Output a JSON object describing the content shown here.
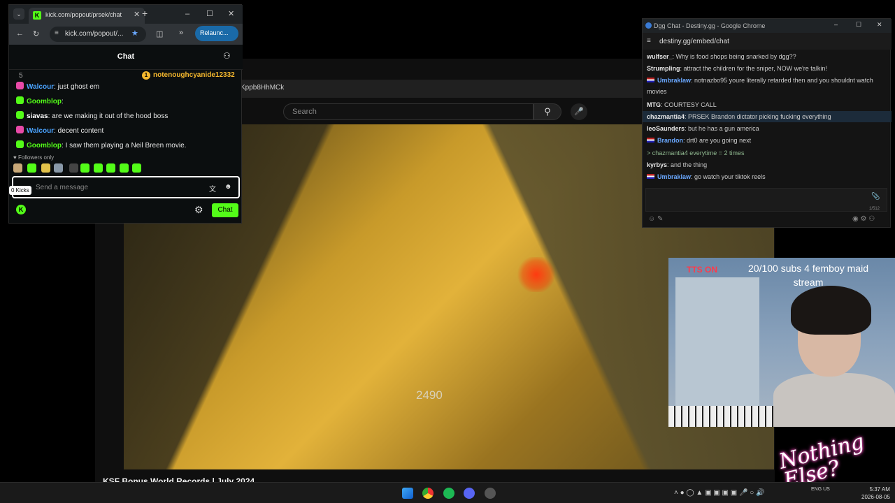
{
  "youtube": {
    "url_fragment": "Kppb8HhMCk",
    "search_placeholder": "Search",
    "video_title": "KSF Bonus World Records | July 2024",
    "game_score": "2490"
  },
  "kick": {
    "tab_title": "kick.com/popout/prsek/chat",
    "url": "kick.com/popout/...",
    "relaunch_label": "Relaunc...",
    "header_title": "Chat",
    "pinned_count": "5",
    "pinned_user": "notenoughcyanide12332",
    "messages": [
      {
        "user": "Walcour",
        "text": "just ghost em",
        "color": "#4aa3ff",
        "badge": "#e84aa8"
      },
      {
        "user": "Goomblop",
        "text": "",
        "color": "#53fc18",
        "badge": "#53fc18"
      },
      {
        "user": "siavas",
        "text": "are we making it out of the hood boss",
        "color": "#ffffff",
        "badge": "#53fc18"
      },
      {
        "user": "Walcour",
        "text": "decent content",
        "color": "#4aa3ff",
        "badge": "#e84aa8"
      },
      {
        "user": "Goomblop",
        "text": "I saw them playing a Neil Breen movie.",
        "color": "#53fc18",
        "badge": "#53fc18"
      }
    ],
    "followers_only": "Followers only",
    "input_placeholder": "Send a message",
    "tooltip": "0 Kicks",
    "chat_button": "Chat",
    "accent": "#53fc18"
  },
  "dgg": {
    "window_title": "Dgg Chat - Destiny.gg - Google Chrome",
    "url": "destiny.gg/embed/chat",
    "lines": [
      {
        "user": "wulfser_",
        "text": "Why is food shops being snarked by dgg??",
        "flag": false
      },
      {
        "user": "Strumpling",
        "text": "attract the children for the sniper, NOW we're talkin!",
        "flag": false
      },
      {
        "user": "Umbraklaw",
        "text": "notnazbo95 youre literally retarded then and you shouldnt watch",
        "flag": true
      },
      {
        "user": "",
        "text": "movies",
        "flag": false
      },
      {
        "user": "MTG",
        "text": "COURTESY CALL",
        "flag": false
      },
      {
        "user": "chazmantia4",
        "text": "PRSEK Brandon dictator picking fucking everything",
        "flag": false
      },
      {
        "user": "leoSaunders",
        "text": "but he has a gun       america",
        "flag": false
      },
      {
        "user": "Brandon",
        "text": "drt0 are you going next",
        "flag": true
      },
      {
        "user": "",
        "text": "> chazmantia4 everytime = 2 times",
        "flag": false
      },
      {
        "user": "kyrbys",
        "text": "and the thing",
        "flag": false
      },
      {
        "user": "Umbraklaw",
        "text": "go watch your tiktok reels",
        "flag": true
      }
    ],
    "counter": "1/512"
  },
  "stream": {
    "overlay_text": "20/100 subs 4 femboy maid stream",
    "tts": "TTS ON",
    "logo_text": "Nothing Else?"
  },
  "taskbar": {
    "lang": "ENG US",
    "time": "5:37 AM",
    "date": "2026-08-05"
  }
}
